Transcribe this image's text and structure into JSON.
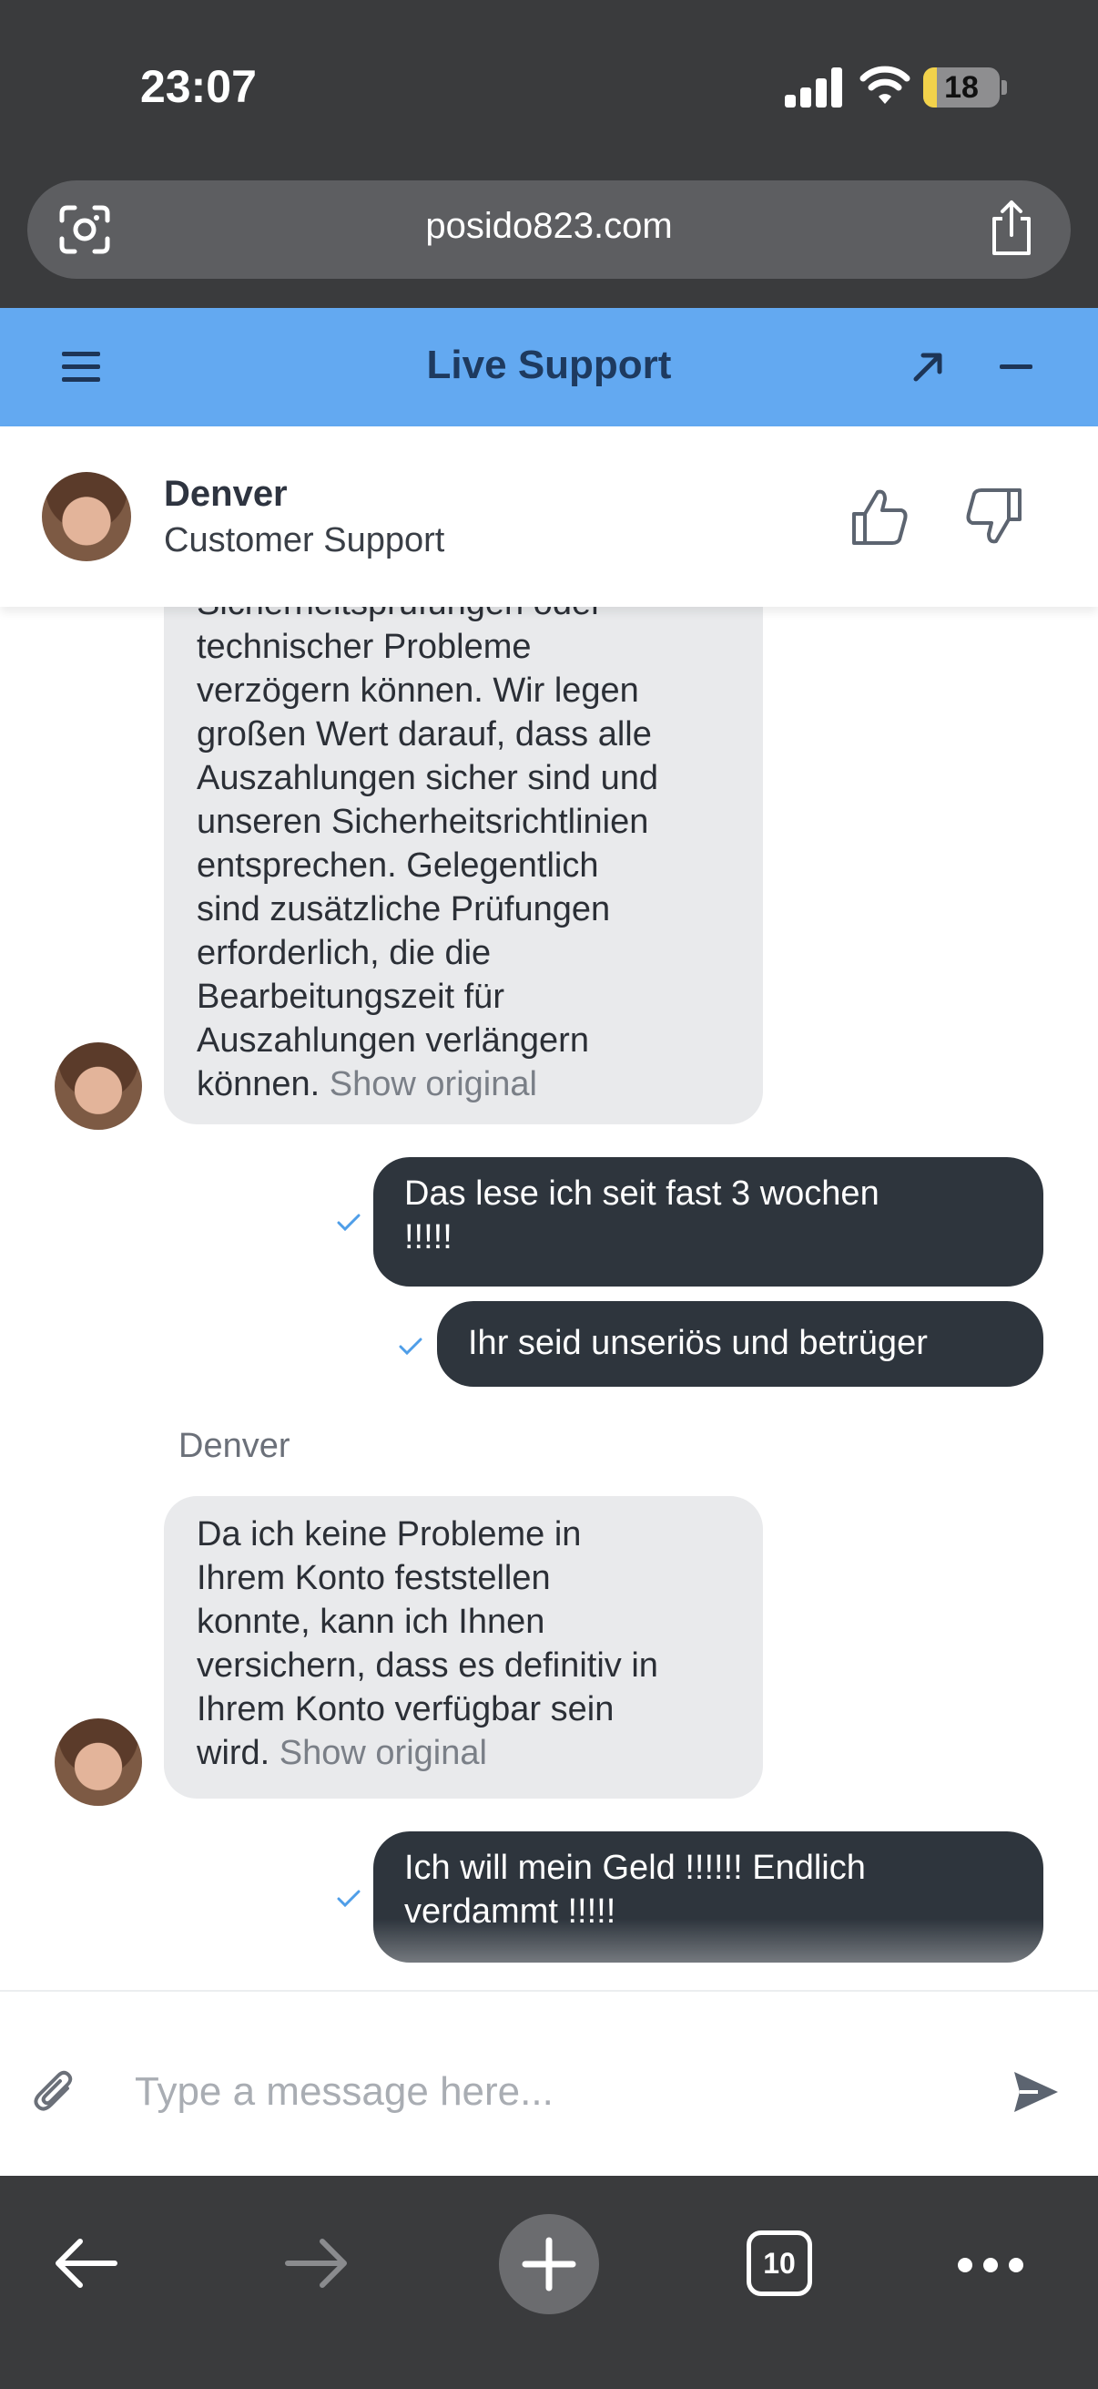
{
  "status_bar": {
    "time": "23:07",
    "battery": "18",
    "battery_level": 0.18
  },
  "browser": {
    "url": "posido823.com",
    "open_tabs": "10"
  },
  "chat": {
    "title": "Live Support",
    "agent": {
      "name": "Denver",
      "role": "Customer Support"
    },
    "messages": [
      {
        "from": "agent",
        "lines": [
          "Sicherheitsprüfungen oder",
          "technischer Probleme",
          "verzögern können. Wir legen",
          "großen Wert darauf, dass alle",
          "Auszahlungen sicher sind und",
          "unseren Sicherheitsrichtlinien",
          "entsprechen. Gelegentlich",
          "sind zusätzliche Prüfungen",
          "erforderlich, die die",
          "Bearbeitungszeit für",
          "Auszahlungen verlängern",
          "können."
        ],
        "show_original": "Show original"
      },
      {
        "from": "user",
        "lines": [
          "Das lese ich seit fast 3 wochen",
          "!!!!!"
        ]
      },
      {
        "from": "user",
        "lines": [
          "Ihr seid unseriös und betrüger"
        ]
      },
      {
        "from": "agent",
        "sender": "Denver",
        "lines": [
          "Da ich keine Probleme in",
          "Ihrem Konto feststellen",
          "konnte, kann ich Ihnen",
          "versichern, dass es definitiv in",
          "Ihrem Konto verfügbar sein",
          "wird."
        ],
        "show_original": "Show original"
      },
      {
        "from": "user",
        "lines": [
          "Ich will mein Geld !!!!!! Endlich",
          "verdammt !!!!!"
        ]
      }
    ]
  },
  "composer": {
    "placeholder": "Type a message here..."
  },
  "icons": {
    "menu": "hamburger-icon",
    "expand": "arrow-up-right-icon",
    "minimize": "minus-icon",
    "like": "thumbs-up-icon",
    "dislike": "thumbs-down-icon",
    "attach": "paperclip-icon",
    "send": "send-icon",
    "lens": "camera-lens-icon",
    "share": "share-icon",
    "back": "back-arrow-icon",
    "forward": "forward-arrow-icon",
    "new_tab": "plus-icon",
    "more": "more-icon"
  },
  "colors": {
    "header": "#63a9f1",
    "user_bubble": "#2e353d",
    "agent_bubble": "#e9eaec",
    "check": "#4f9ee8"
  }
}
